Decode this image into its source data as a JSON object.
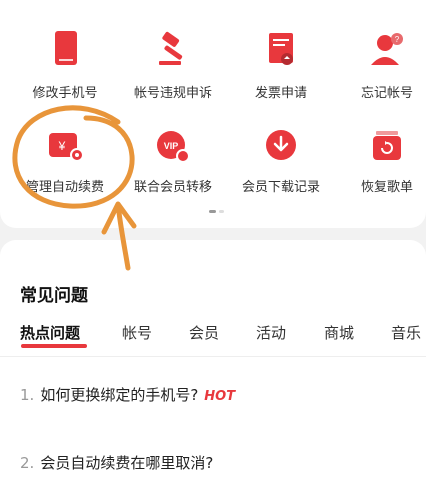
{
  "colors": {
    "accent": "#e8383d",
    "annotation": "#e8953a"
  },
  "services": [
    {
      "label": "修改手机号",
      "icon": "phone-icon"
    },
    {
      "label": "帐号违规申诉",
      "icon": "gavel-icon"
    },
    {
      "label": "发票申请",
      "icon": "invoice-icon"
    },
    {
      "label": "忘记帐号",
      "icon": "user-question-icon"
    },
    {
      "label": "管理自动续费",
      "icon": "auto-renew-icon"
    },
    {
      "label": "联合会员转移",
      "icon": "vip-transfer-icon"
    },
    {
      "label": "会员下载记录",
      "icon": "download-icon"
    },
    {
      "label": "恢复歌单",
      "icon": "restore-playlist-icon"
    }
  ],
  "faq": {
    "title": "常见问题",
    "tabs": [
      "热点问题",
      "帐号",
      "会员",
      "活动",
      "商城",
      "音乐"
    ],
    "questions": [
      {
        "num": "1.",
        "text": "如何更换绑定的手机号?",
        "badge": "HOT"
      },
      {
        "num": "2.",
        "text": "会员自动续费在哪里取消?"
      }
    ]
  }
}
